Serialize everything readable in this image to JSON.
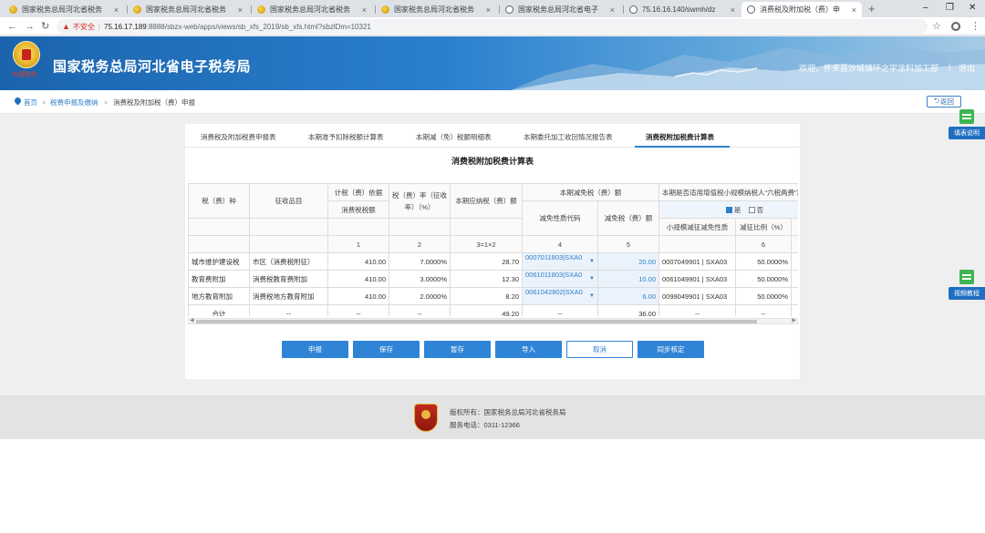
{
  "browser": {
    "tabs": [
      {
        "title": "国家税务总局河北省税务",
        "icon": "gold"
      },
      {
        "title": "国家税务总局河北省税务",
        "icon": "gold"
      },
      {
        "title": "国家税务总局河北省税务",
        "icon": "gold"
      },
      {
        "title": "国家税务总局河北省税务",
        "icon": "gold"
      },
      {
        "title": "国家税务总局河北省电子",
        "icon": "globe"
      },
      {
        "title": "75.16.16.140/swmh/dz",
        "icon": "globe"
      },
      {
        "title": "消费税及附加税（费）申",
        "icon": "globe",
        "active": true
      }
    ],
    "close_glyph": "×",
    "new_tab": "+",
    "window_controls": [
      "–",
      "❐",
      "✕"
    ],
    "insecure_label": "不安全",
    "url_host": "75.16.17.189",
    "url_path": ":8888/sbzx-web/apps/views/sb_xfs_2019/sb_xfs.html?sbzlDm=10321"
  },
  "header": {
    "emblem_text": "中国税务",
    "title": "国家税务总局河北省电子税务局",
    "welcome": "欢迎，怀来县沙城镇环之宇涂料加工部",
    "separator": "|",
    "logout": "退出"
  },
  "breadcrumb": {
    "home": "首页",
    "sep": ">",
    "level1": "税费申报及缴纳",
    "current": "消费税及附加税（费）申报",
    "back": "返回"
  },
  "side": {
    "guide": "填表说明",
    "video": "视频教程"
  },
  "subtabs": [
    "消费税及附加税费申报表",
    "本期准予扣除税额计算表",
    "本期减（免）税额明细表",
    "本期委托加工收回情况报告表",
    "消费税附加税费计算表"
  ],
  "table": {
    "title": "消费税附加税费计算表",
    "headers": {
      "tax_type": "税（费）种",
      "item": "征收品目",
      "basis_group": "计税（费）依据",
      "basis": "消费税税额",
      "rate": "税（费）率（征收率）（%）",
      "payable": "本期应纳税（费）额",
      "relief_group": "本期减免税（费）额",
      "relief_code": "减免性质代码",
      "relief_amount": "减免税（费）额",
      "small_group": "本期是否适用增值税小规模纳税人“六税两费”减征政策",
      "yes": "是",
      "no": "否",
      "small_code": "小规模减征减免性质",
      "small_ratio": "减征比例（%）"
    },
    "col_numbers": [
      "1",
      "2",
      "3=1×2",
      "4",
      "5",
      "",
      "6"
    ],
    "rows": [
      {
        "tax_type": "城市维护建设税",
        "item": "市区（消费税附征）",
        "basis": "410.00",
        "rate": "7.0000%",
        "payable": "28.70",
        "relief_code": "0007011803|SXA0",
        "relief_amount": "20.00",
        "small_code": "0007049901 | SXA03",
        "small_ratio": "50.0000%"
      },
      {
        "tax_type": "教育费附加",
        "item": "消费税教育费附加",
        "basis": "410.00",
        "rate": "3.0000%",
        "payable": "12.30",
        "relief_code": "0061011803|SXA0",
        "relief_amount": "10.00",
        "small_code": "0061049901 | SXA03",
        "small_ratio": "50.0000%"
      },
      {
        "tax_type": "地方教育附加",
        "item": "消费税地方教育附加",
        "basis": "410.00",
        "rate": "2.0000%",
        "payable": "8.20",
        "relief_code": "0061042802|SXA0",
        "relief_amount": "6.00",
        "small_code": "0099049901 | SXA03",
        "small_ratio": "50.0000%"
      }
    ],
    "total": {
      "label": "合计",
      "dash": "--",
      "payable": "49.20",
      "relief_amount": "36.00"
    },
    "dropdown_glyph": "▼"
  },
  "buttons": {
    "declare": "申报",
    "save": "保存",
    "draft": "暂存",
    "import": "导入",
    "cancel": "取消",
    "sync": "同步核定"
  },
  "footer": {
    "copyright": "版权所有：国家税务总局河北省税务局",
    "phone": "服务电话：0311-12366"
  },
  "colors": {
    "primary": "#2f84d6",
    "header_blue": "#1b64ad",
    "insecure_red": "#d93025"
  }
}
